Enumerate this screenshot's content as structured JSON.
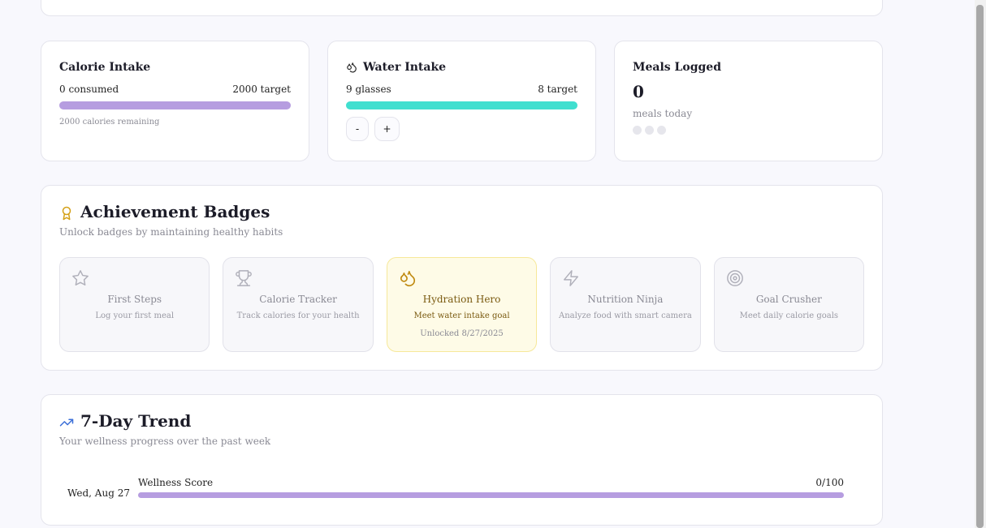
{
  "calorie": {
    "title": "Calorie Intake",
    "consumed": "0 consumed",
    "target": "2000 target",
    "remaining": "2000 calories remaining",
    "progress": 1.0
  },
  "water": {
    "title": "Water Intake",
    "icon": "droplets-icon",
    "glasses": "9 glasses",
    "target": "8 target",
    "progress": 1.0,
    "minus_label": "-",
    "plus_label": "+"
  },
  "meals": {
    "title": "Meals Logged",
    "count": "0",
    "subtitle": "meals today",
    "dots": 3
  },
  "badges": {
    "title": "Achievement Badges",
    "icon": "award-icon",
    "subtitle": "Unlock badges by maintaining healthy habits",
    "items": [
      {
        "name": "First Steps",
        "desc": "Log your first meal",
        "icon": "star-icon",
        "unlocked": false,
        "date": ""
      },
      {
        "name": "Calorie Tracker",
        "desc": "Track calories for your health",
        "icon": "trophy-icon",
        "unlocked": false,
        "date": ""
      },
      {
        "name": "Hydration Hero",
        "desc": "Meet water intake goal",
        "icon": "droplets-icon",
        "unlocked": true,
        "date": "Unlocked 8/27/2025"
      },
      {
        "name": "Nutrition Ninja",
        "desc": "Analyze food with smart camera",
        "icon": "zap-icon",
        "unlocked": false,
        "date": ""
      },
      {
        "name": "Goal Crusher",
        "desc": "Meet daily calorie goals",
        "icon": "target-icon",
        "unlocked": false,
        "date": ""
      }
    ]
  },
  "trend": {
    "title": "7-Day Trend",
    "icon": "trending-up-icon",
    "subtitle": "Your wellness progress over the past week",
    "rows": [
      {
        "date": "Wed, Aug 27",
        "label": "Wellness Score",
        "score": "0/100"
      }
    ]
  },
  "colors": {
    "purple_bar": "#b69de0",
    "teal_bar": "#40dfcf",
    "gold": "#d4a017",
    "blue": "#3b6fd8"
  }
}
